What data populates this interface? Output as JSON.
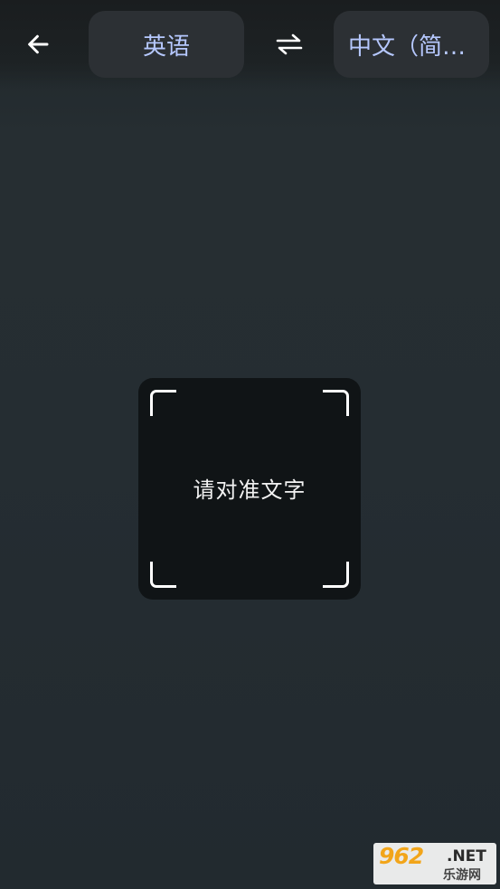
{
  "header": {
    "back_icon": "arrow-left-icon",
    "source_language": "英语",
    "swap_icon": "swap-arrows-icon",
    "target_language": "中文（简体）",
    "pill_text_color": "#b6c8ff",
    "pill_background": "#2c3034"
  },
  "viewfinder": {
    "hint": "请对准文字",
    "background": "#101416",
    "corner_color": "#ffffff"
  },
  "watermark": {
    "number": "962",
    "suffix": ".NET",
    "site": "乐游网"
  }
}
